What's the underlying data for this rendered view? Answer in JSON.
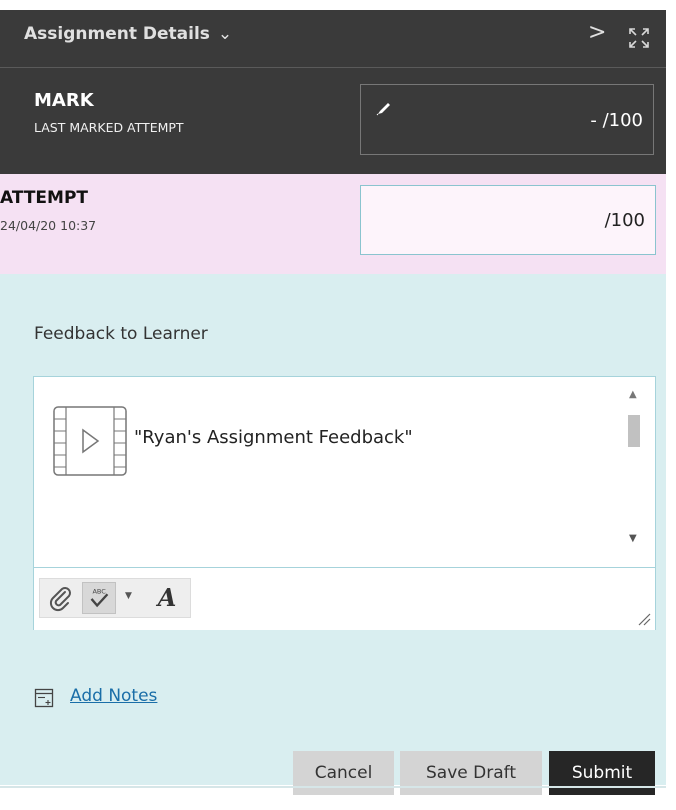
{
  "header": {
    "title": "Assignment Details",
    "dropdown_glyph": "⌄",
    "next_glyph": ">",
    "expand_icon": "expand-icon"
  },
  "mark": {
    "title": "MARK",
    "subtitle": "LAST MARKED ATTEMPT",
    "value": "- /100",
    "edit_icon": "pencil-icon"
  },
  "attempt": {
    "title": "ATTEMPT",
    "date": "24/04/20 10:37",
    "value": "/100"
  },
  "feedback": {
    "label": "Feedback to Learner",
    "content_text": "\"Ryan's Assignment Feedback\"",
    "content_icon": "video-file-icon",
    "toolbar": [
      "attach-icon",
      "spellcheck-icon",
      "font-style-icon"
    ],
    "font_glyph": "A"
  },
  "notes": {
    "link_text": "Add Notes",
    "icon": "notes-icon"
  },
  "actions": {
    "cancel": "Cancel",
    "save_draft": "Save Draft",
    "submit": "Submit"
  },
  "colors": {
    "header_bg": "#3a3a3a",
    "attempt_bg": "#f5e1f3",
    "feedback_bg": "#d9eef0",
    "link": "#1a6ea8",
    "submit_bg": "#262626"
  }
}
